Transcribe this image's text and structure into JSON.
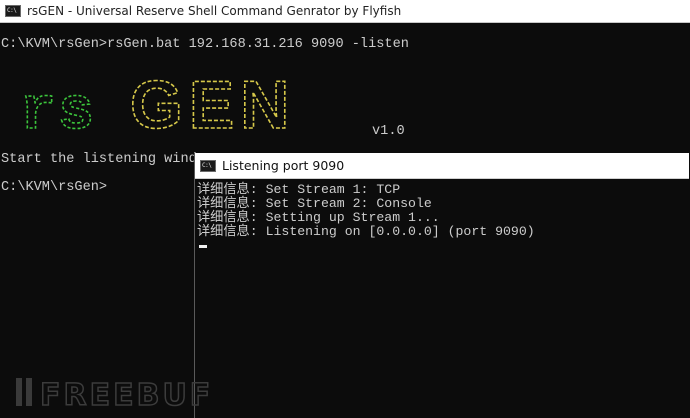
{
  "main_window": {
    "title": "rsGEN - Universal Reserve Shell Command Genrator by Flyfish",
    "icon": "cmd-icon",
    "icon_text": "C:\\"
  },
  "console": {
    "command_line": "C:\\KVM\\rsGen>rsGen.bat 192.168.31.216 9090 -listen",
    "banner_text": "rsGEN",
    "version": "v1.0",
    "status_line": "Start the listening window",
    "prompt": "C:\\KVM\\rsGen>",
    "banner_colors": {
      "rs": "#3cc43c",
      "gen": "#d6c84a"
    }
  },
  "listener_window": {
    "title": "Listening port 9090",
    "icon": "cmd-icon",
    "icon_text": "C:\\",
    "lines": [
      "详细信息: Set Stream 1: TCP",
      "详细信息: Set Stream 2: Console",
      "详细信息: Setting up Stream 1...",
      "详细信息: Listening on [0.0.0.0] (port 9090)"
    ]
  },
  "watermark": {
    "text": "FREEBUF"
  }
}
